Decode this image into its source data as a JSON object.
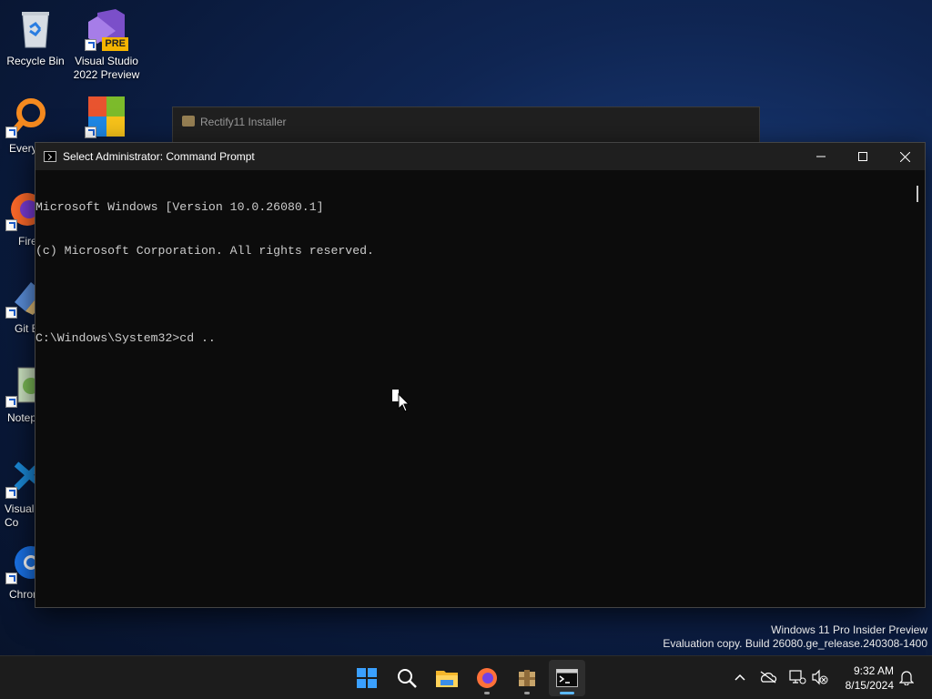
{
  "desktop": {
    "icons": [
      {
        "label": "Recycle Bin"
      },
      {
        "label": "Visual Studio 2022 Preview",
        "badge": "PRE"
      },
      {
        "label": "Every"
      },
      {
        "label": "Fire"
      },
      {
        "label": "Git E"
      },
      {
        "label": "Notep"
      },
      {
        "label": "Visual Co"
      },
      {
        "label": "Chron"
      }
    ]
  },
  "background_window": {
    "title": "Rectify11 Installer"
  },
  "cmd_window": {
    "title": "Select Administrator: Command Prompt",
    "lines": [
      "Microsoft Windows [Version 10.0.26080.1]",
      "(c) Microsoft Corporation. All rights reserved.",
      "",
      "C:\\Windows\\System32>cd .."
    ]
  },
  "watermark": {
    "line1": "Windows 11 Pro Insider Preview",
    "line2": "Evaluation copy. Build 26080.ge_release.240308-1400"
  },
  "taskbar": {
    "items": [
      {
        "name": "start-icon"
      },
      {
        "name": "search-icon"
      },
      {
        "name": "file-explorer-icon"
      },
      {
        "name": "firefox-icon"
      },
      {
        "name": "installer-icon"
      },
      {
        "name": "command-prompt-icon"
      }
    ],
    "clock": {
      "time": "9:32 AM",
      "date": "8/15/2024"
    }
  },
  "colors": {
    "accent": "#5cb8ff",
    "terminal_bg": "#0c0c0c",
    "terminal_text": "#cccccc"
  }
}
